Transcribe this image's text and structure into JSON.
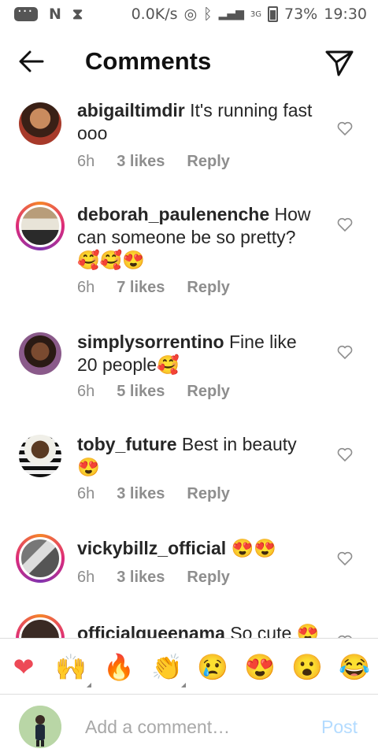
{
  "status_bar": {
    "speed": "0.0K/s",
    "network": "3G",
    "battery": "73%",
    "time": "19:30",
    "carrier_n": "N"
  },
  "header": {
    "title": "Comments"
  },
  "comments": [
    {
      "username": "abigailtimdir",
      "text": "It's running fast ooo",
      "time": "6h",
      "likes": "3 likes",
      "reply": "Reply"
    },
    {
      "username": "deborah_paulenenche",
      "text": "How can someone be so pretty? 🥰🥰😍",
      "time": "6h",
      "likes": "7 likes",
      "reply": "Reply"
    },
    {
      "username": "simplysorrentino",
      "text": "Fine like 20 people🥰",
      "time": "6h",
      "likes": "5 likes",
      "reply": "Reply"
    },
    {
      "username": "toby_future",
      "text": "Best in beauty 😍",
      "time": "6h",
      "likes": "3 likes",
      "reply": "Reply"
    },
    {
      "username": "vickybillz_official",
      "text": "😍😍",
      "time": "6h",
      "likes": "3 likes",
      "reply": "Reply"
    },
    {
      "username": "officialqueenama",
      "text": "So cute 😍",
      "time": "",
      "likes": "",
      "reply": ""
    }
  ],
  "emoji_bar": [
    "❤",
    "🙌",
    "🔥",
    "👏",
    "😢",
    "😍",
    "😮",
    "😂"
  ],
  "composer": {
    "placeholder": "Add a comment…",
    "post_label": "Post"
  }
}
